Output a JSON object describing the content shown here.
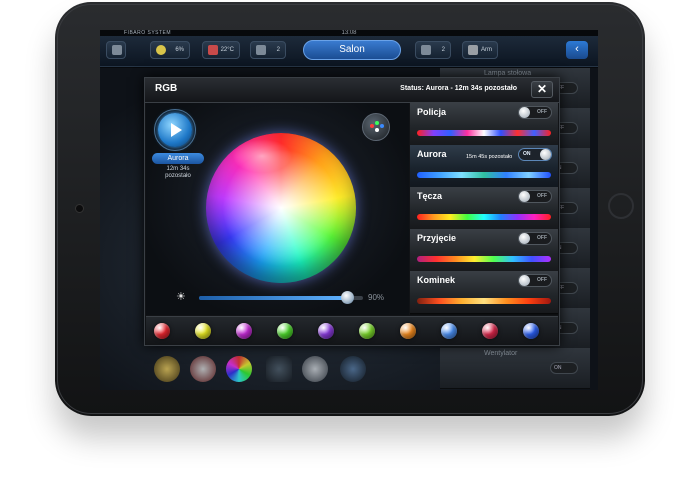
{
  "device": {
    "type": "tablet"
  },
  "status_bar": {
    "time": "13:08",
    "brand": "FIBARO SYSTEM"
  },
  "topbar": {
    "room": "Salon",
    "items": [
      {
        "icon": "lightbulb-icon",
        "value": "6%"
      },
      {
        "icon": "thermometer-icon",
        "value": "22°C"
      },
      {
        "icon": "device-count-icon",
        "value": "2"
      },
      {
        "icon": "scene-icon",
        "value": "2"
      },
      {
        "icon": "alarm-icon",
        "value": "Arm"
      }
    ],
    "back_icon": "chevron-left-icon"
  },
  "dialog": {
    "title": "RGB",
    "status": "Status: Aurora - 12m 34s pozostało",
    "close_label": "✕"
  },
  "current_program": {
    "name": "Aurora",
    "remaining_line1": "12m 34s",
    "remaining_line2": "pozostało"
  },
  "brightness": {
    "label": "90%",
    "value": 90
  },
  "programs": [
    {
      "name": "Policja",
      "state": "OFF",
      "on": false,
      "remaining": "",
      "gradient": "gb1"
    },
    {
      "name": "Aurora",
      "state": "ON",
      "on": true,
      "remaining": "15m 45s pozostało",
      "gradient": "gb2"
    },
    {
      "name": "Tęcza",
      "state": "OFF",
      "on": false,
      "remaining": "",
      "gradient": "gb3"
    },
    {
      "name": "Przyjęcie",
      "state": "OFF",
      "on": false,
      "remaining": "",
      "gradient": "gb4"
    },
    {
      "name": "Kominek",
      "state": "OFF",
      "on": false,
      "remaining": "",
      "gradient": "gb5"
    }
  ],
  "swatches": [
    "#e8262f",
    "#e6e622",
    "#c52bd6",
    "#4cd62b",
    "#8a3bdc",
    "#7ad62b",
    "#f08a1f",
    "#4a8ef0",
    "#d8264a",
    "#2a5ef0"
  ],
  "background": {
    "list_items": [
      {
        "label": "Lampa stołowa",
        "state": "OFF"
      },
      {
        "label": "",
        "state": "OFF"
      },
      {
        "label": "",
        "state": "ON"
      },
      {
        "label": "",
        "state": "OFF"
      },
      {
        "label": "",
        "state": "ON"
      },
      {
        "label": "",
        "state": "OFF"
      },
      {
        "label": "",
        "state": "ON"
      },
      {
        "label": "Wentylator",
        "state": "ON"
      }
    ]
  }
}
